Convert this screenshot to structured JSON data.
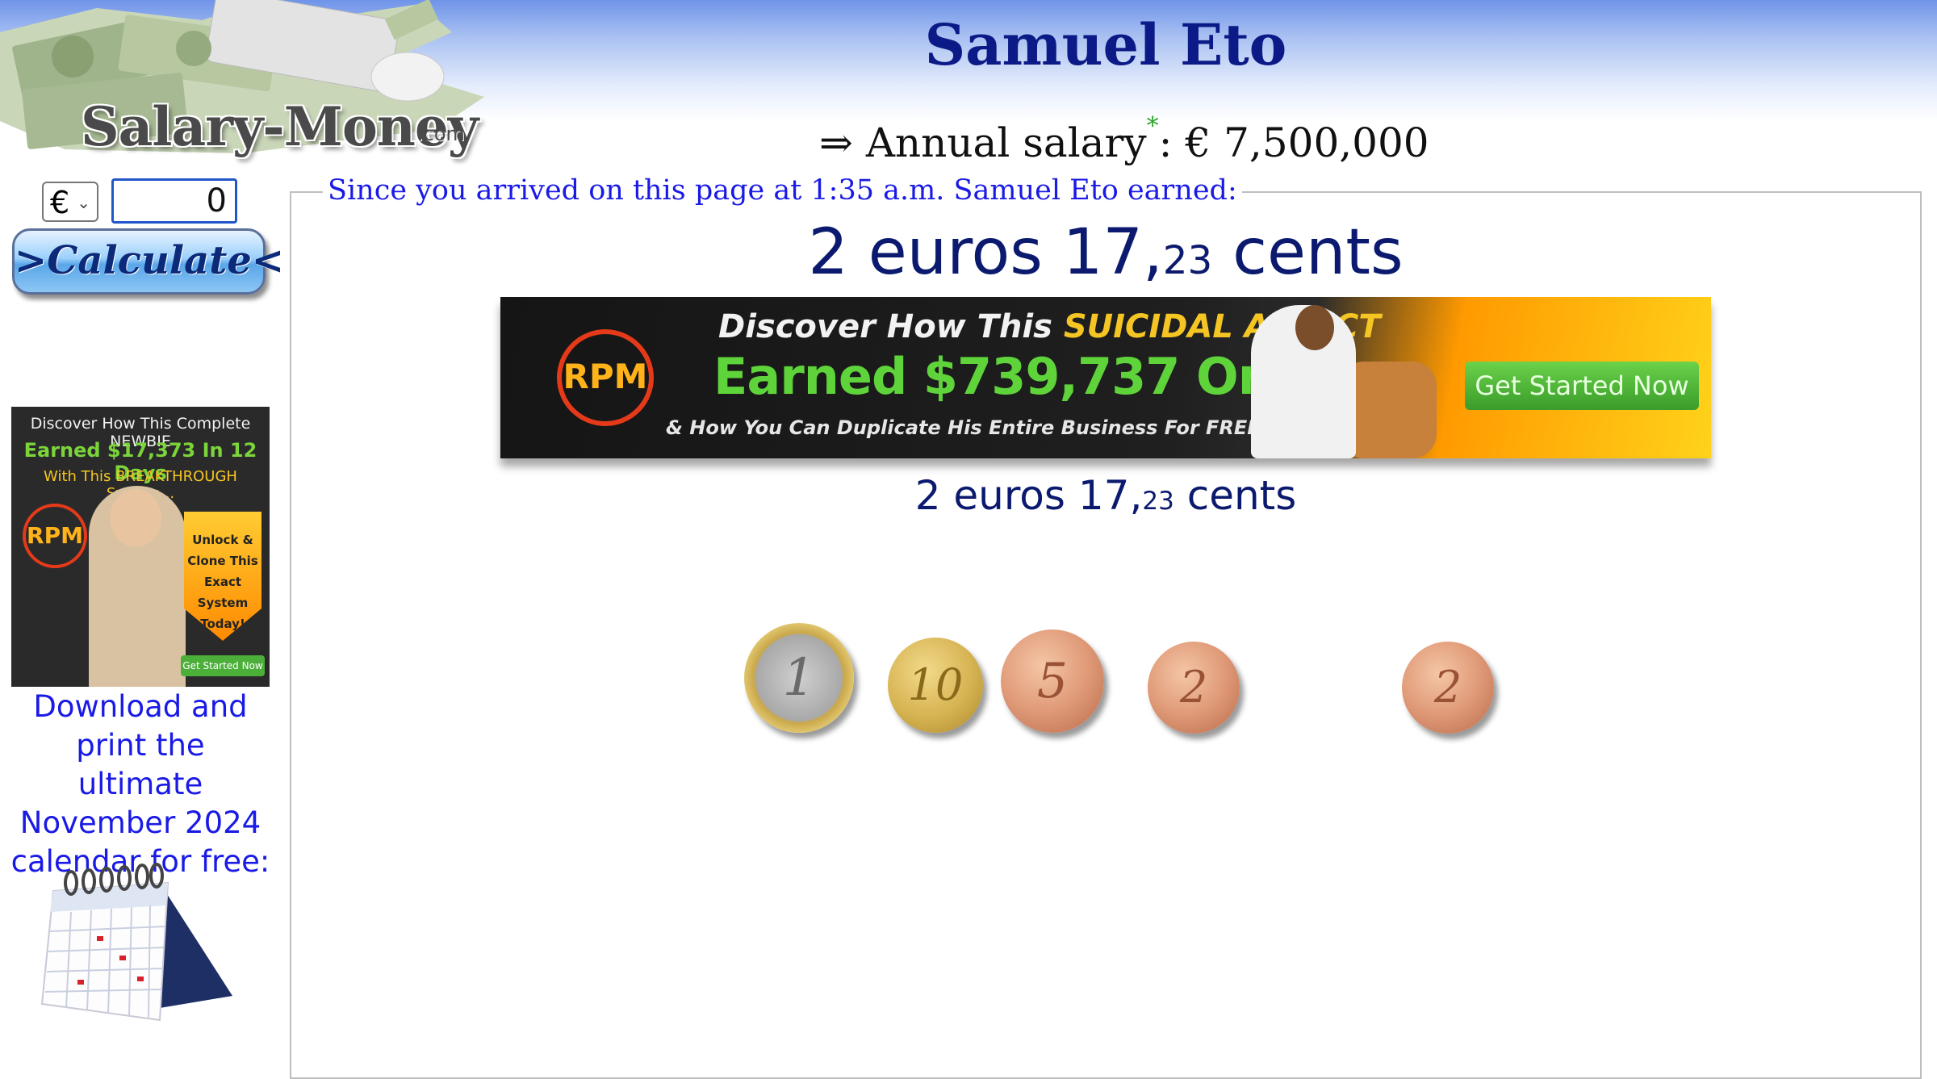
{
  "site": {
    "logo_text": "Salary-Money",
    "logo_suffix": ".com"
  },
  "page": {
    "title": "Samuel Eto",
    "salary_arrow": "⇒",
    "salary_label": "Annual salary",
    "salary_marker": "*",
    "salary_separator": ":",
    "salary_value": "€ 7,500,000"
  },
  "calculator": {
    "currency_selected": "€",
    "amount_value": "0",
    "calculate_label": ">Calculate<"
  },
  "earnings": {
    "legend": "Since you arrived on this page at 1:35 a.m. Samuel Eto earned:",
    "euros_text": "2 euros 17,",
    "cents_value": "23",
    "cents_word": " cents"
  },
  "side_ad": {
    "line1": "Discover How This Complete NEWBIE",
    "line2": "Earned $17,373 In 12 Days",
    "line3": "With This BREAKTHROUGH System...",
    "logo": "RPM",
    "arrow_text": "Unlock & Clone This Exact System Today!",
    "button": "Get Started Now"
  },
  "banner_ad": {
    "line1_a": "Discover How This ",
    "line1_b": "SUICIDAL ADDICT",
    "line2": "Earned $739,737 Online",
    "line3": "& How You Can Duplicate His Entire Business For FREE...",
    "logo": "RPM",
    "button": "Get Started Now"
  },
  "calendar_promo": {
    "text": "Download and print the ultimate November 2024 calendar for free:"
  },
  "coins": [
    {
      "name": "1 euro",
      "label": "1"
    },
    {
      "name": "10 cent",
      "label": "10"
    },
    {
      "name": "5 cent",
      "label": "5"
    },
    {
      "name": "2 cent",
      "label": "2"
    },
    {
      "name": "2 cent",
      "label": "2"
    }
  ],
  "colors": {
    "title": "#0b1a86",
    "link_blue": "#1a1ae6",
    "earnings_text": "#0b1a6e",
    "header_gradient_top": "#6f93e8"
  }
}
